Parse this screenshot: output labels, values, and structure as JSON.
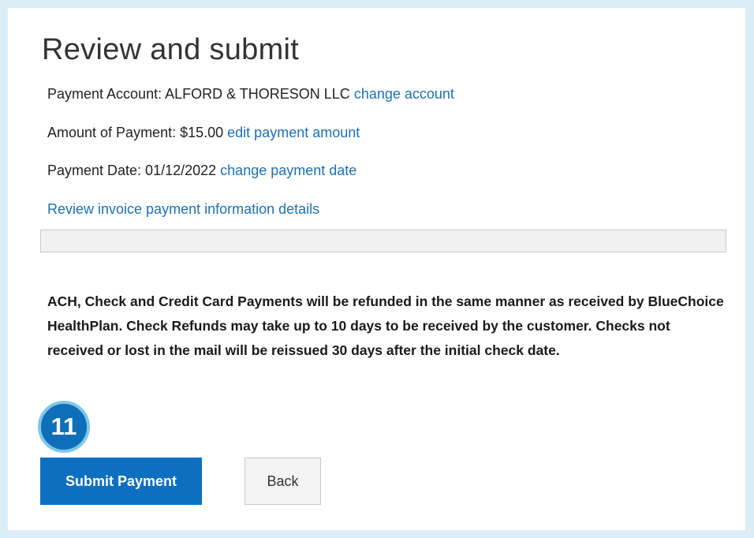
{
  "page": {
    "title": "Review and submit"
  },
  "details": {
    "account_label": "Payment Account: ALFORD & THORESON LLC",
    "account_link": "change account",
    "amount_label": "Amount of Payment: $15.00",
    "amount_link": "edit payment amount",
    "date_label": "Payment Date: 01/12/2022",
    "date_link": "change payment date",
    "invoice_link": "Review invoice payment information details"
  },
  "notice": {
    "text": "ACH, Check and Credit Card Payments will be refunded in the same manner as received by BlueChoice HealthPlan. Check Refunds may take up to 10 days to be received by the customer. Checks not received or lost in the mail will be reissued 30 days after the initial check date."
  },
  "step_badge": {
    "number": "11"
  },
  "actions": {
    "submit_label": "Submit Payment",
    "back_label": "Back"
  },
  "colors": {
    "background": "#dcedf7",
    "link": "#1f6fb5",
    "primary_button": "#0d6fc0",
    "badge_fill": "#0d6fb8",
    "badge_ring": "#7fc7e8"
  }
}
